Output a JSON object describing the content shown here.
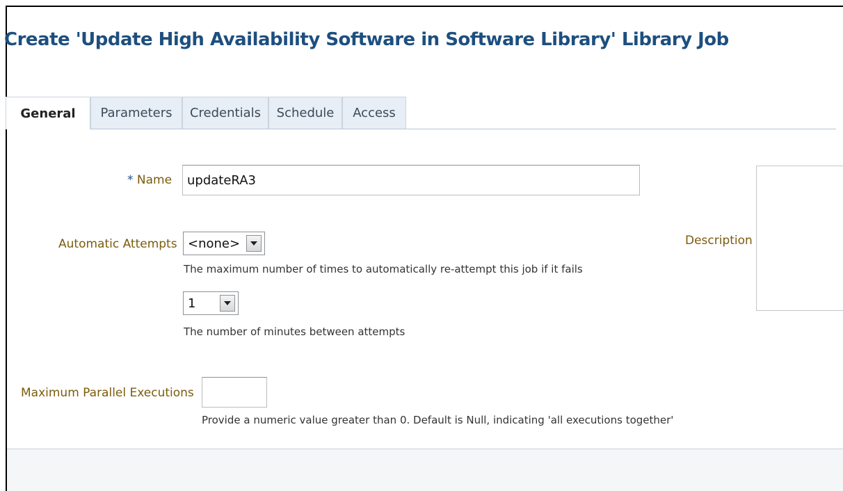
{
  "page": {
    "title": "Create 'Update High Availability Software in Software Library' Library Job"
  },
  "tabs": [
    {
      "label": "General",
      "active": true
    },
    {
      "label": "Parameters",
      "active": false
    },
    {
      "label": "Credentials",
      "active": false
    },
    {
      "label": "Schedule",
      "active": false
    },
    {
      "label": "Access",
      "active": false
    }
  ],
  "form": {
    "name": {
      "required_marker": "*",
      "label": "Name",
      "value": "updateRA3"
    },
    "automatic_attempts": {
      "label": "Automatic Attempts",
      "selected": "<none>",
      "hint": "The maximum number of times to automatically re-attempt this job if it fails"
    },
    "minutes_between": {
      "selected": "1",
      "hint": "The number of minutes between attempts"
    },
    "max_parallel": {
      "label": "Maximum Parallel Executions",
      "value": "",
      "hint": "Provide a numeric value greater than 0. Default is Null, indicating 'all executions together'"
    },
    "description": {
      "label": "Description",
      "value": ""
    }
  },
  "icons": {
    "dropdown": "chevron-down-icon"
  },
  "colors": {
    "title": "#1d4f7f",
    "label": "#7a5c0c",
    "tab_bg": "#e7eef5"
  }
}
